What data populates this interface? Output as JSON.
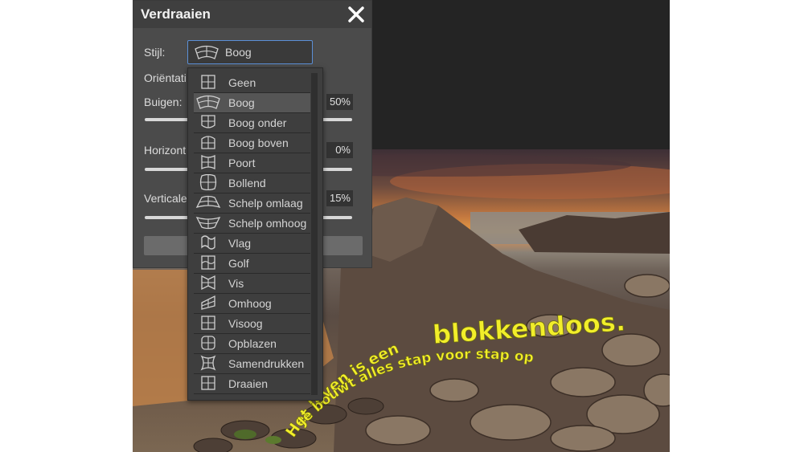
{
  "dialog": {
    "title": "Verdraaien",
    "style_label": "Stijl:",
    "style_value": "Boog",
    "orientation_label": "Oriëntati",
    "bend_label": "Buigen:",
    "bend_value": "50%",
    "bend_level": 0.5,
    "horizontal_label": "Horizont",
    "horizontal_value": "0%",
    "horizontal_level": 0.0,
    "vertical_label": "Verticale",
    "vertical_value": "15%",
    "vertical_level": 0.15
  },
  "dropdown": {
    "items": [
      {
        "label": "Geen",
        "icon": "grid-icon"
      },
      {
        "label": "Boog",
        "icon": "arc-icon"
      },
      {
        "label": "Boog onder",
        "icon": "arc-lower-icon"
      },
      {
        "label": "Boog boven",
        "icon": "arc-upper-icon"
      },
      {
        "label": "Poort",
        "icon": "arch-icon"
      },
      {
        "label": "Bollend",
        "icon": "bulge-icon"
      },
      {
        "label": "Schelp omlaag",
        "icon": "shell-lower-icon"
      },
      {
        "label": "Schelp omhoog",
        "icon": "shell-upper-icon"
      },
      {
        "label": "Vlag",
        "icon": "flag-icon"
      },
      {
        "label": "Golf",
        "icon": "wave-icon"
      },
      {
        "label": "Vis",
        "icon": "fish-icon"
      },
      {
        "label": "Omhoog",
        "icon": "rise-icon"
      },
      {
        "label": "Visoog",
        "icon": "fisheye-icon"
      },
      {
        "label": "Opblazen",
        "icon": "inflate-icon"
      },
      {
        "label": "Samendrukken",
        "icon": "squeeze-icon"
      },
      {
        "label": "Draaien",
        "icon": "twist-icon"
      }
    ],
    "selected": "Boog"
  },
  "canvas_text": {
    "line1a": "Het leven is een",
    "line1b": "blokkendoos.",
    "line2": "Je bouwt alles stap voor stap op"
  },
  "colors": {
    "dialog_bg": "#4b4b4b",
    "header_bg": "#3f3f3f",
    "accent_border": "#5b8fd6",
    "text_yellow": "#f2ee2a"
  }
}
